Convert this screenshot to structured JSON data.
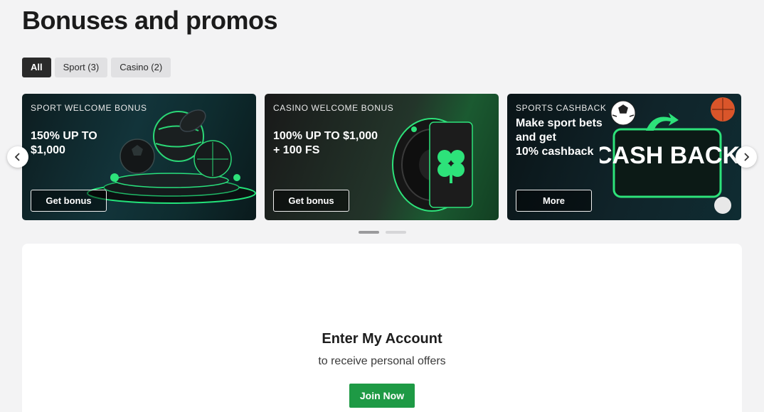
{
  "page": {
    "title": "Bonuses and promos"
  },
  "filters": [
    {
      "label": "All",
      "active": true
    },
    {
      "label": "Sport (3)",
      "active": false
    },
    {
      "label": "Casino (2)",
      "active": false
    }
  ],
  "promos": [
    {
      "kicker": "SPORT WELCOME BONUS",
      "headline": "150% UP TO\n $1,000",
      "button": "Get bonus",
      "art": "sport-balls-podium"
    },
    {
      "kicker": "CASINO WELCOME BONUS",
      "headline": "100% UP TO $1,000\n+ 100 FS",
      "button": "Get bonus",
      "art": "roulette-clover"
    },
    {
      "kicker": "SPORTS CASHBACK",
      "headline": "Make sport bets\nand get\n10% cashback",
      "button": "More",
      "art": "cashback-sign",
      "art_text": "CASH BACK"
    }
  ],
  "carousel": {
    "prev_icon": "chevron-left-icon",
    "next_icon": "chevron-right-icon",
    "pages": 2,
    "current_page": 1
  },
  "account": {
    "title": "Enter My Account",
    "subtitle": "to receive personal offers",
    "button": "Join Now"
  },
  "colors": {
    "accent": "#1e9a45",
    "neon": "#2de27a",
    "page_bg": "#f3f3f4"
  }
}
